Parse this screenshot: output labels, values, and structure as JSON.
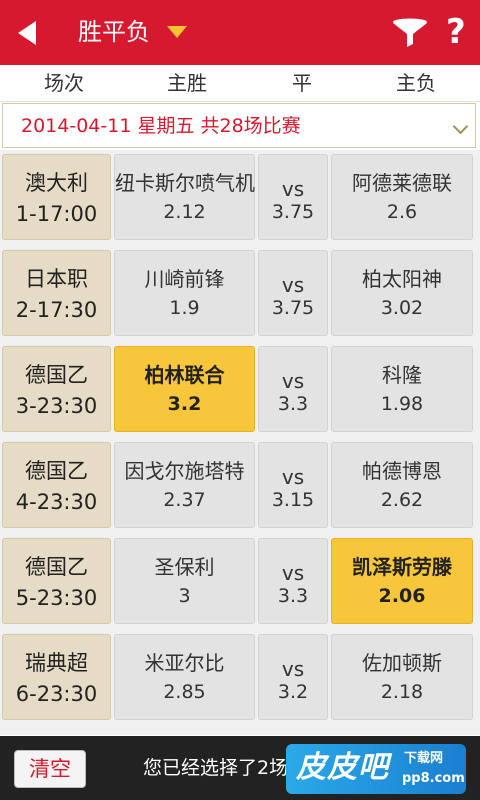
{
  "header": {
    "title": "胜平负",
    "help_label": "?"
  },
  "columns": [
    "场次",
    "主胜",
    "平",
    "主负"
  ],
  "date_bar": {
    "text": "2014-04-11  星期五  共28场比赛"
  },
  "matches": [
    {
      "league": "澳大利",
      "code": "1-17:00",
      "home": "纽卡斯尔喷气机",
      "home_odds": "2.12",
      "draw_label": "vs",
      "draw_odds": "3.75",
      "away": "阿德莱德联",
      "away_odds": "2.6",
      "selected": ""
    },
    {
      "league": "日本职",
      "code": "2-17:30",
      "home": "川崎前锋",
      "home_odds": "1.9",
      "draw_label": "vs",
      "draw_odds": "3.75",
      "away": "柏太阳神",
      "away_odds": "3.02",
      "selected": ""
    },
    {
      "league": "德国乙",
      "code": "3-23:30",
      "home": "柏林联合",
      "home_odds": "3.2",
      "draw_label": "vs",
      "draw_odds": "3.3",
      "away": "科隆",
      "away_odds": "1.98",
      "selected": "home"
    },
    {
      "league": "德国乙",
      "code": "4-23:30",
      "home": "因戈尔施塔特",
      "home_odds": "2.37",
      "draw_label": "vs",
      "draw_odds": "3.15",
      "away": "帕德博恩",
      "away_odds": "2.62",
      "selected": ""
    },
    {
      "league": "德国乙",
      "code": "5-23:30",
      "home": "圣保利",
      "home_odds": "3",
      "draw_label": "vs",
      "draw_odds": "3.3",
      "away": "凯泽斯劳滕",
      "away_odds": "2.06",
      "selected": "away"
    },
    {
      "league": "瑞典超",
      "code": "6-23:30",
      "home": "米亚尔比",
      "home_odds": "2.85",
      "draw_label": "vs",
      "draw_odds": "3.2",
      "away": "佐加顿斯",
      "away_odds": "2.18",
      "selected": ""
    }
  ],
  "footer": {
    "clear_label": "清空",
    "status": "您已经选择了2场"
  },
  "watermark": {
    "main": "皮皮吧",
    "sub1": "下载网",
    "sub2": "pp8.com"
  },
  "colors": {
    "brand_red": "#d7192f",
    "selected_yellow": "#f7c63b",
    "league_beige": "#e6dcc5"
  },
  "icons": [
    "back-icon",
    "dropdown-icon",
    "filter-icon",
    "help-icon",
    "chevron-down-icon"
  ]
}
